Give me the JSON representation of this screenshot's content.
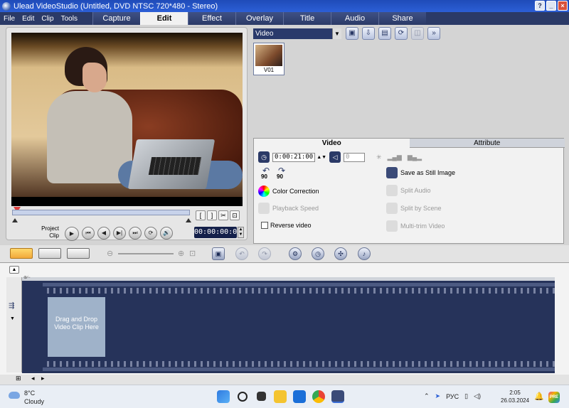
{
  "window": {
    "title": "Ulead VideoStudio (Untitled, DVD NTSC 720*480 - Stereo)",
    "controls": [
      "?",
      "_",
      "×"
    ]
  },
  "menu": {
    "items": [
      "File",
      "Edit",
      "Clip",
      "Tools"
    ]
  },
  "steps": [
    {
      "label": "Capture",
      "active": false
    },
    {
      "label": "Edit",
      "active": true
    },
    {
      "label": "Effect",
      "active": false
    },
    {
      "label": "Overlay",
      "active": false
    },
    {
      "label": "Title",
      "active": false
    },
    {
      "label": "Audio",
      "active": false
    },
    {
      "label": "Share",
      "active": false
    }
  ],
  "player": {
    "mode_project": "Project",
    "mode_clip": "Clip",
    "timecode": "00:00:00:00",
    "scrub_position": 0.02,
    "trim_buttons": [
      "[",
      "]",
      "✂",
      "⊡"
    ],
    "controls": [
      "▶",
      "⏮",
      "◀",
      "▶|",
      "⏭",
      "⟳",
      "🔊"
    ]
  },
  "library": {
    "category": "Video",
    "dropdown_arrow": "▼",
    "tool_icons": [
      "folder-icon",
      "import-icon",
      "storyboard-icon",
      "refresh-icon",
      "options-icon",
      "expand-icon"
    ],
    "clips": [
      {
        "label": "V01"
      }
    ]
  },
  "options": {
    "tabs": [
      {
        "label": "Video",
        "active": true
      },
      {
        "label": "Attribute",
        "active": false
      }
    ],
    "duration": "0:00:21:00",
    "volume_value": "0",
    "rotate_left_label": "90",
    "rotate_right_label": "90",
    "color_correction": "Color Correction",
    "playback_speed": "Playback Speed",
    "reverse_video": "Reverse video",
    "save_still": "Save as Still Image",
    "split_audio": "Split Audio",
    "split_by_scene": "Split by Scene",
    "multi_trim": "Multi-trim Video"
  },
  "timeline": {
    "drop_zone_text": "Drag and Drop Video Clip Here",
    "ruler_label": "⊕∕−"
  },
  "taskbar": {
    "weather_temp": "8°C",
    "weather_desc": "Cloudy",
    "language": "РУС",
    "time": "2:05",
    "date": "26.03.2024",
    "badge": "PRE"
  },
  "colors": {
    "title_bar": "#2c5fd6",
    "menu_bar": "#2b3a67",
    "storyboard": "#26335a",
    "drop_zone": "#9fb2c9",
    "timecode_bg": "#14204a"
  }
}
